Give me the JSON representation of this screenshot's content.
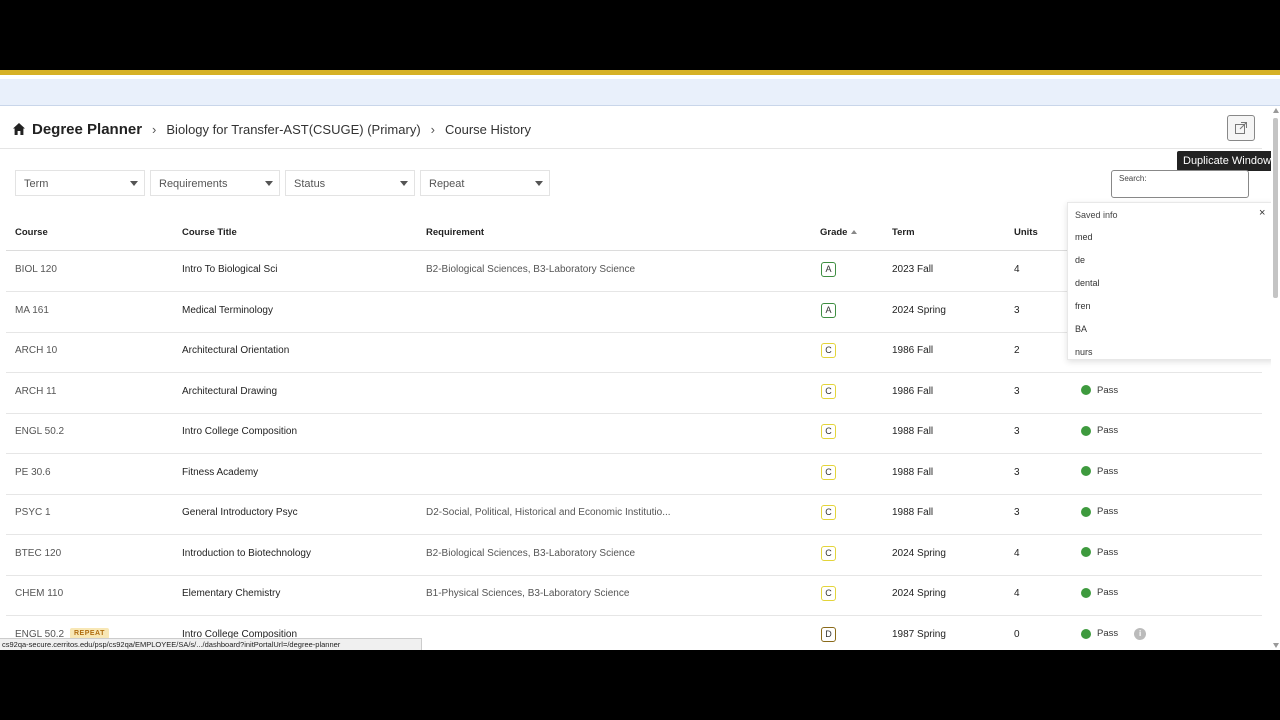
{
  "breadcrumb": {
    "home": "Degree Planner",
    "program": "Biology for Transfer-AST(CSUGE) (Primary)",
    "current": "Course History"
  },
  "toolbar": {
    "duplicate_tooltip": "Duplicate Window"
  },
  "filters": {
    "term": "Term",
    "requirements": "Requirements",
    "status": "Status",
    "repeat": "Repeat"
  },
  "search": {
    "label": "Search:",
    "value": ""
  },
  "saved_info": {
    "header": "Saved info",
    "close": "×",
    "items": [
      "med",
      "de",
      "dental",
      "fren",
      "BA",
      "nurs"
    ]
  },
  "table": {
    "headers": {
      "course": "Course",
      "title": "Course Title",
      "requirement": "Requirement",
      "grade": "Grade",
      "term": "Term",
      "units": "Units"
    },
    "rows": [
      {
        "course": "BIOL 120",
        "title": "Intro To Biological Sci",
        "requirement": "B2-Biological Sciences, B3-Laboratory Science",
        "grade": "A",
        "term": "2023 Fall",
        "units": "4",
        "status": ""
      },
      {
        "course": "MA 161",
        "title": "Medical Terminology",
        "requirement": "",
        "grade": "A",
        "term": "2024 Spring",
        "units": "3",
        "status": ""
      },
      {
        "course": "ARCH 10",
        "title": "Architectural Orientation",
        "requirement": "",
        "grade": "C",
        "term": "1986 Fall",
        "units": "2",
        "status": ""
      },
      {
        "course": "ARCH 11",
        "title": "Architectural Drawing",
        "requirement": "",
        "grade": "C",
        "term": "1986 Fall",
        "units": "3",
        "status": "Pass"
      },
      {
        "course": "ENGL 50.2",
        "title": "Intro College Composition",
        "requirement": "",
        "grade": "C",
        "term": "1988 Fall",
        "units": "3",
        "status": "Pass"
      },
      {
        "course": "PE 30.6",
        "title": "Fitness Academy",
        "requirement": "",
        "grade": "C",
        "term": "1988 Fall",
        "units": "3",
        "status": "Pass"
      },
      {
        "course": "PSYC 1",
        "title": "General Introductory Psyc",
        "requirement": "D2-Social, Political, Historical and Economic Institutio...",
        "grade": "C",
        "term": "1988 Fall",
        "units": "3",
        "status": "Pass"
      },
      {
        "course": "BTEC 120",
        "title": "Introduction to Biotechnology",
        "requirement": "B2-Biological Sciences, B3-Laboratory Science",
        "grade": "C",
        "term": "2024 Spring",
        "units": "4",
        "status": "Pass"
      },
      {
        "course": "CHEM 110",
        "title": "Elementary Chemistry",
        "requirement": "B1-Physical Sciences, B3-Laboratory Science",
        "grade": "C",
        "term": "2024 Spring",
        "units": "4",
        "status": "Pass"
      },
      {
        "course": "ENGL 50.2",
        "badge": "REPEAT",
        "title": "Intro College Composition",
        "requirement": "",
        "grade": "D",
        "term": "1987 Spring",
        "units": "0",
        "status": "Pass",
        "info": "i"
      }
    ]
  },
  "colors": {
    "grade_A": "#3e8e41",
    "grade_C": "#e3d43a",
    "grade_D": "#8a6a1a",
    "pass_dot": "#3e9a3e",
    "accent_gold": "#d6b125"
  },
  "status_bar": "cs92qa-secure.cerritos.edu/psp/cs92qa/EMPLOYEE/SA/s/.../dashboard?initPortalUrl=/degree-planner"
}
